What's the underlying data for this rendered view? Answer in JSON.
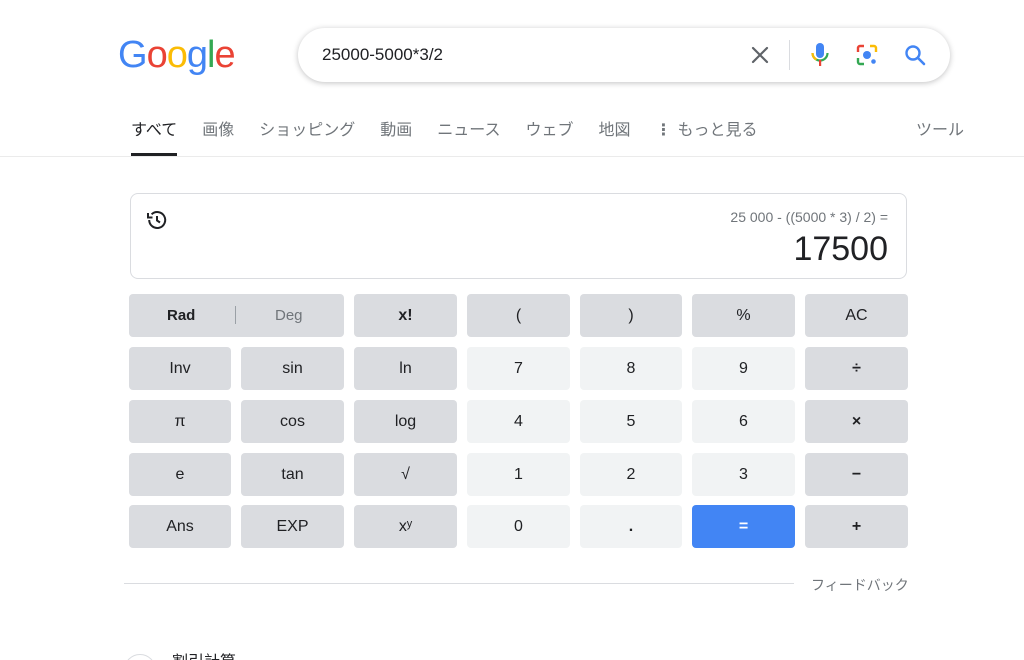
{
  "logo": {
    "letters": [
      "G",
      "o",
      "o",
      "g",
      "l",
      "e"
    ],
    "colors": [
      "#4285f4",
      "#ea4335",
      "#fbbc05",
      "#4285f4",
      "#34a853",
      "#ea4335"
    ]
  },
  "search": {
    "value": "25000-5000*3/2",
    "icons": [
      "close-icon",
      "microphone-icon",
      "lens-icon",
      "search-icon"
    ]
  },
  "tabs": [
    {
      "label": "すべて",
      "active": true
    },
    {
      "label": "画像"
    },
    {
      "label": "ショッピング"
    },
    {
      "label": "動画"
    },
    {
      "label": "ニュース"
    },
    {
      "label": "ウェブ"
    },
    {
      "label": "地図"
    },
    {
      "label": "もっと見る",
      "icon": "more-vert-icon"
    }
  ],
  "tools_label": "ツール",
  "calculator": {
    "expression": "25 000 - ((5000 * 3) / 2) =",
    "result": "17500",
    "rad_label": "Rad",
    "deg_label": "Deg",
    "keys": {
      "fact": "x!",
      "lparen": "(",
      "rparen": ")",
      "percent": "%",
      "ac": "AC",
      "inv": "Inv",
      "sin": "sin",
      "ln": "ln",
      "k7": "7",
      "k8": "8",
      "k9": "9",
      "div": "÷",
      "pi": "π",
      "cos": "cos",
      "log": "log",
      "k4": "4",
      "k5": "5",
      "k6": "6",
      "mul": "×",
      "e": "e",
      "tan": "tan",
      "sqrt": "√",
      "k1": "1",
      "k2": "2",
      "k3": "3",
      "minus": "−",
      "ans": "Ans",
      "exp": "EXP",
      "pow": "xʸ",
      "k0": "0",
      "dot": ".",
      "eq": "=",
      "plus": "+"
    },
    "colors": {
      "equals": "#4285f4",
      "operator_bg": "#dadce0",
      "digit_bg": "#f1f3f4"
    }
  },
  "feedback_label": "フィードバック",
  "next_result": "割引計算"
}
